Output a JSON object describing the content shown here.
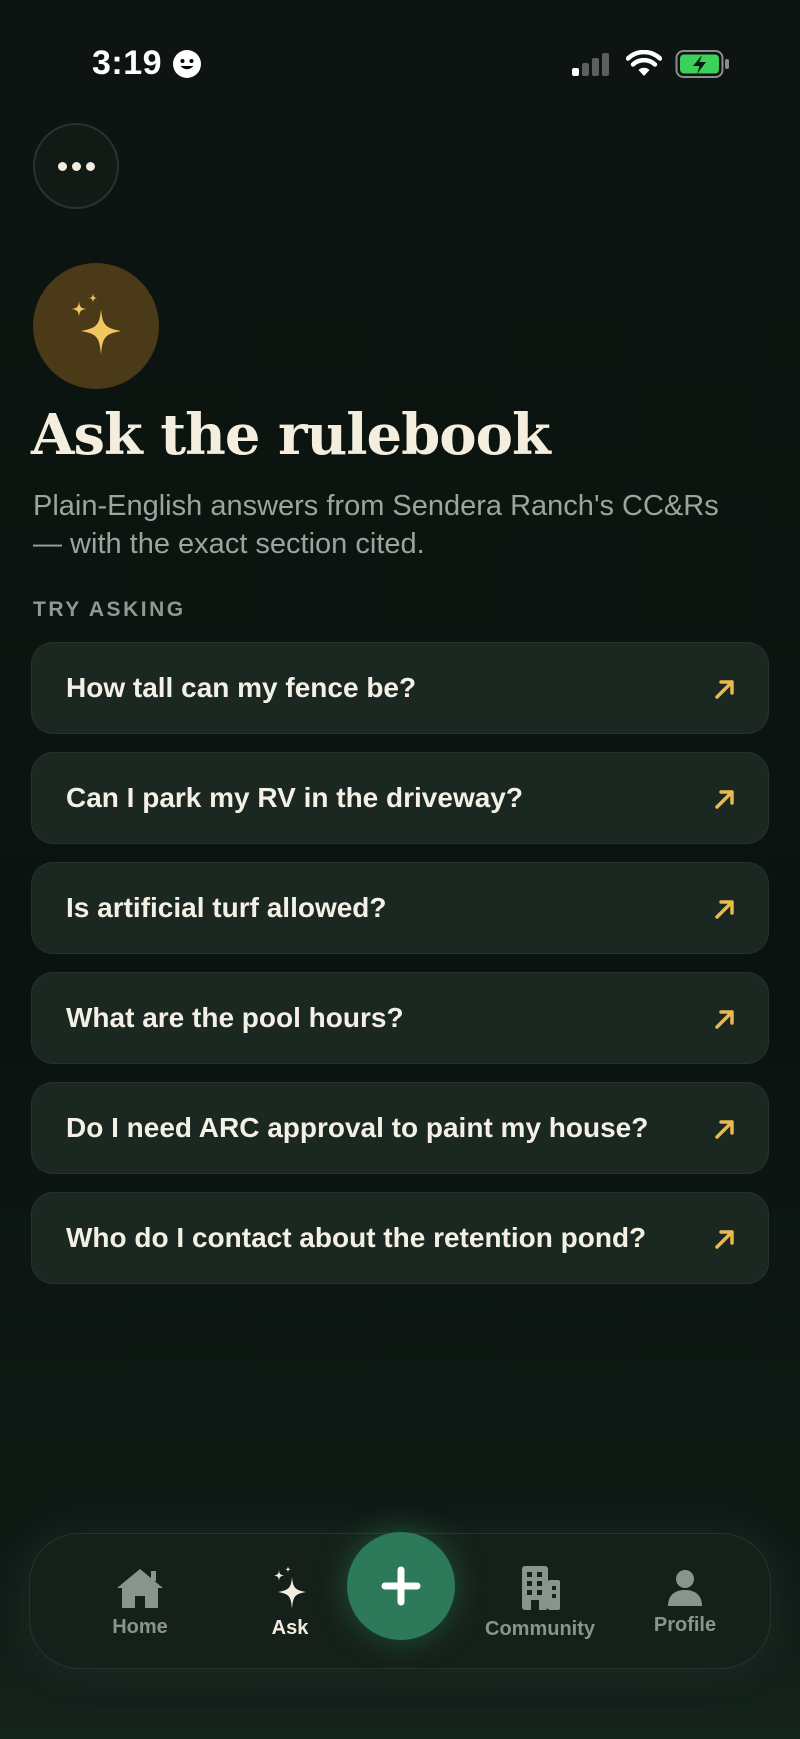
{
  "status_bar": {
    "time": "3:19"
  },
  "header": {
    "more_button_icon": "ellipsis-icon"
  },
  "hero": {
    "badge_icon": "sparkles-icon",
    "title": "Ask the rulebook",
    "subtitle": "Plain-English answers from Sendera Ranch's CC&Rs — with the exact section cited."
  },
  "suggestions": {
    "label": "TRY ASKING",
    "items": [
      {
        "text": "How tall can my fence be?"
      },
      {
        "text": "Can I park my RV in the driveway?"
      },
      {
        "text": "Is artificial turf allowed?"
      },
      {
        "text": "What are the pool hours?"
      },
      {
        "text": "Do I need ARC approval to paint my house?"
      },
      {
        "text": "Who do I contact about the retention pond?"
      }
    ]
  },
  "tab_bar": {
    "tabs": [
      {
        "label": "Home",
        "icon": "house-icon",
        "active": false
      },
      {
        "label": "Ask",
        "icon": "sparkles-icon",
        "active": true
      },
      {
        "label": "Community",
        "icon": "building-icon",
        "active": false
      },
      {
        "label": "Profile",
        "icon": "person-icon",
        "active": false
      }
    ],
    "fab_icon": "plus-icon"
  },
  "colors": {
    "background": "#0c1310",
    "card": "#1b2721",
    "accent_gold": "#e9b94c",
    "accent_green": "#2c7a59",
    "badge_bg": "#4a3a18"
  }
}
